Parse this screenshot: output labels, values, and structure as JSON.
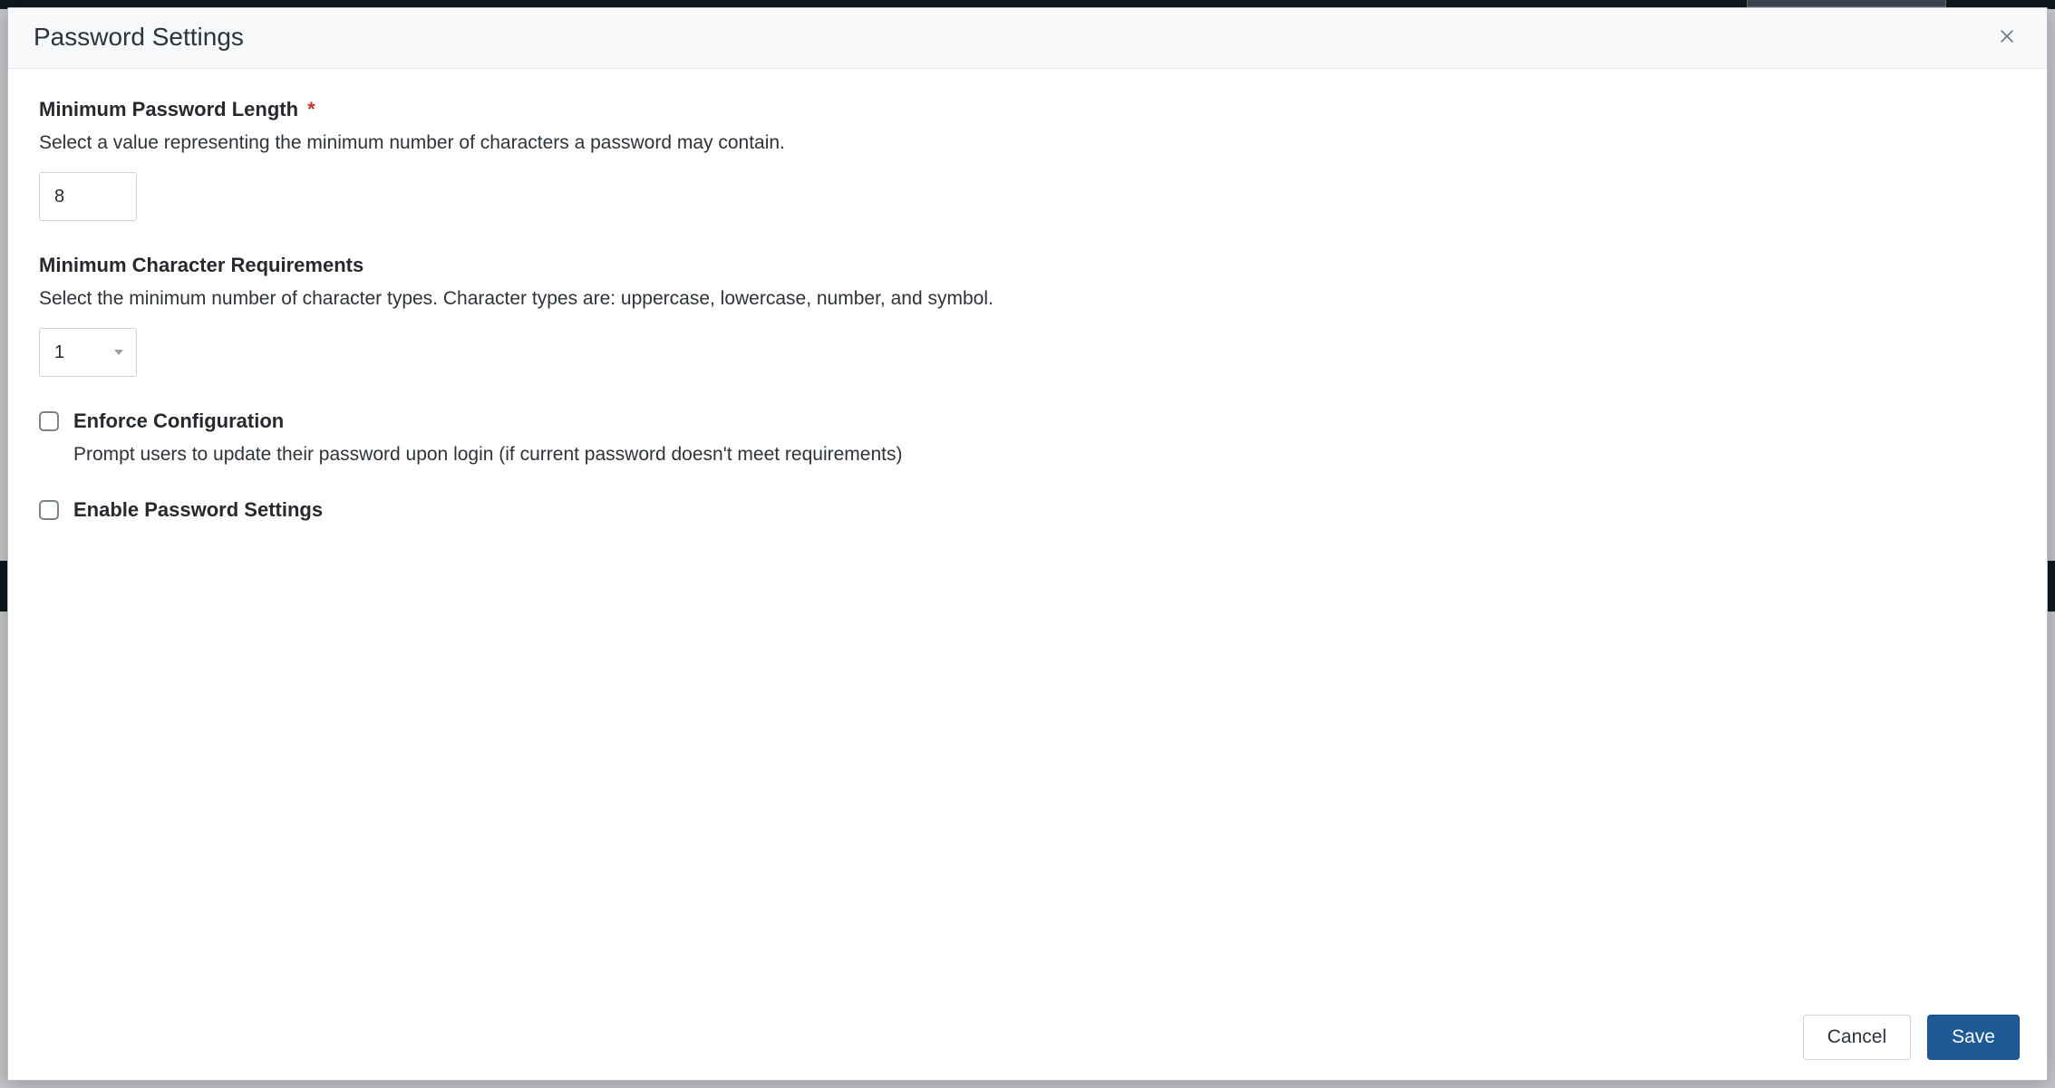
{
  "modal": {
    "title": "Password Settings"
  },
  "fields": {
    "min_length": {
      "label": "Minimum Password Length",
      "required_marker": "*",
      "help": "Select a value representing the minimum number of characters a password may contain.",
      "value": "8"
    },
    "min_char_req": {
      "label": "Minimum Character Requirements",
      "help": "Select the minimum number of character types. Character types are: uppercase, lowercase, number, and symbol.",
      "value": "1"
    },
    "enforce": {
      "label": "Enforce Configuration",
      "help": "Prompt users to update their password upon login (if current password doesn't meet requirements)"
    },
    "enable": {
      "label": "Enable Password Settings"
    }
  },
  "footer": {
    "cancel": "Cancel",
    "save": "Save"
  }
}
